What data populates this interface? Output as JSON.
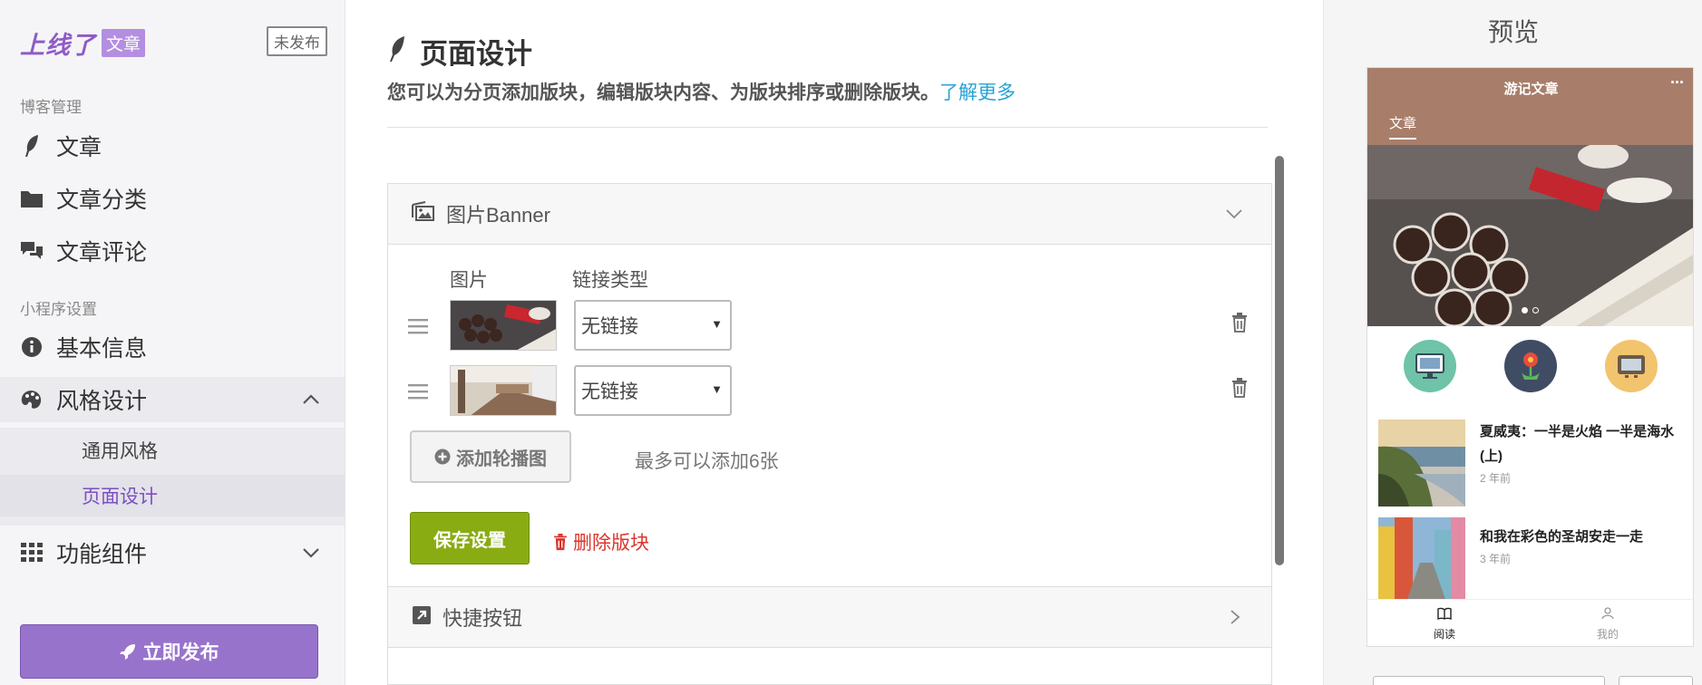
{
  "brand": {
    "logo": "上线了",
    "tag": "文章",
    "status": "未发布"
  },
  "sidebar": {
    "group_blog": "博客管理",
    "group_miniapp": "小程序设置",
    "items": [
      {
        "label": "文章",
        "icon": "feather-icon"
      },
      {
        "label": "文章分类",
        "icon": "folder-icon"
      },
      {
        "label": "文章评论",
        "icon": "comments-icon"
      },
      {
        "label": "基本信息",
        "icon": "info-icon"
      },
      {
        "label": "风格设计",
        "icon": "palette-icon"
      },
      {
        "label": "功能组件",
        "icon": "grid-icon"
      }
    ],
    "sub_items": [
      {
        "label": "通用风格"
      },
      {
        "label": "页面设计"
      }
    ],
    "publish_label": "立即发布"
  },
  "main": {
    "title": "页面设计",
    "description": "您可以为分页添加版块，编辑版块内容、为版块排序或删除版块。",
    "learn_more": "了解更多",
    "banner_panel": {
      "title": "图片Banner",
      "col_image": "图片",
      "col_link": "链接类型",
      "rows": [
        {
          "link_type": "无链接"
        },
        {
          "link_type": "无链接"
        }
      ],
      "add_label": "添加轮播图",
      "hint": "最多可以添加6张",
      "save_label": "保存设置",
      "delete_label": "删除版块"
    },
    "shortcut_panel": {
      "title": "快捷按钮"
    }
  },
  "preview": {
    "title": "预览",
    "nav_title": "游记文章",
    "more": "···",
    "tab": "文章",
    "articles": [
      {
        "title": "夏威夷：一半是火焰 一半是海水(上)",
        "date": "2 年前"
      },
      {
        "title": "和我在彩色的圣胡安走一走",
        "date": "3 年前"
      }
    ],
    "tabbar": [
      {
        "label": "阅读"
      },
      {
        "label": "我的"
      }
    ]
  },
  "colors": {
    "accent": "#9873cc",
    "save": "#8aac13",
    "danger": "#d9362c",
    "link": "#26a3d6",
    "phone_nav": "#a87e6a"
  }
}
